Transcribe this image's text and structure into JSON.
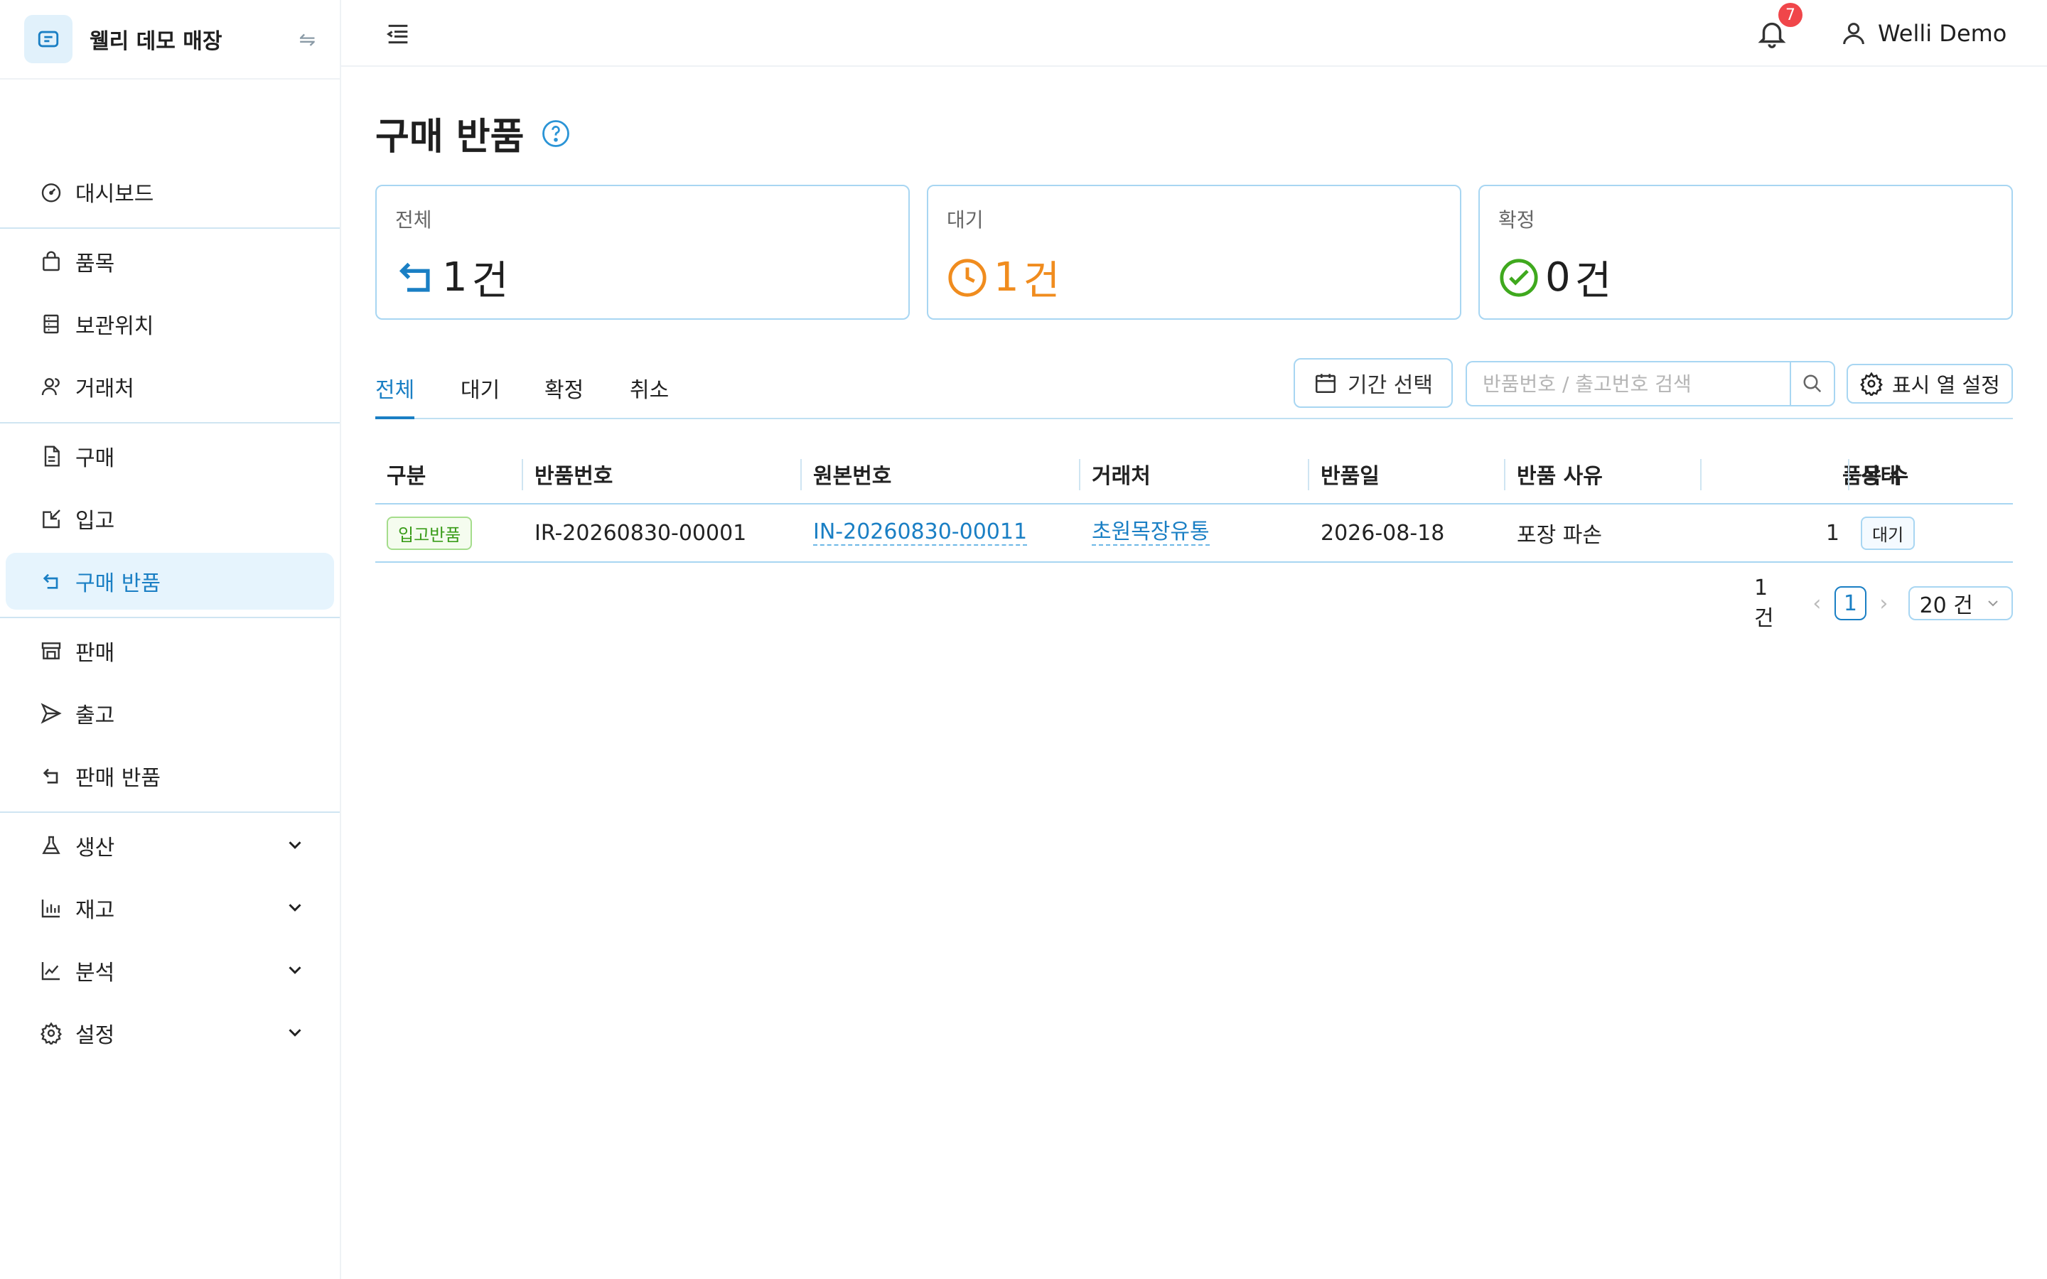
{
  "brand": {
    "name": "웰리 데모 매장",
    "swap_icon": "swap-icon"
  },
  "sidebar": {
    "items": [
      {
        "label": "대시보드",
        "icon": "dashboard-icon"
      },
      {
        "label": "품목",
        "icon": "bag-icon"
      },
      {
        "label": "보관위치",
        "icon": "storage-icon"
      },
      {
        "label": "거래처",
        "icon": "partners-icon"
      },
      {
        "label": "구매",
        "icon": "document-icon"
      },
      {
        "label": "입고",
        "icon": "inbound-icon"
      },
      {
        "label": "구매 반품",
        "icon": "return-icon"
      },
      {
        "label": "판매",
        "icon": "store-icon"
      },
      {
        "label": "출고",
        "icon": "send-icon"
      },
      {
        "label": "판매 반품",
        "icon": "return-icon"
      },
      {
        "label": "생산",
        "icon": "flask-icon"
      },
      {
        "label": "재고",
        "icon": "bar-chart-icon"
      },
      {
        "label": "분석",
        "icon": "line-chart-icon"
      },
      {
        "label": "설정",
        "icon": "gear-icon"
      }
    ],
    "active": "구매 반품"
  },
  "header": {
    "notification_count": "7",
    "user_name": "Welli Demo"
  },
  "page": {
    "title": "구매 반품"
  },
  "stats": [
    {
      "label": "전체",
      "count": "1",
      "unit": "건",
      "color": "#1a7fc4"
    },
    {
      "label": "대기",
      "count": "1",
      "unit": "건",
      "color": "#f08c1e"
    },
    {
      "label": "확정",
      "count": "0",
      "unit": "건",
      "color": "#3fa91e"
    }
  ],
  "tabs": [
    {
      "label": "전체",
      "active": true
    },
    {
      "label": "대기",
      "active": false
    },
    {
      "label": "확정",
      "active": false
    },
    {
      "label": "취소",
      "active": false
    }
  ],
  "toolbar": {
    "period_label": "기간 선택",
    "search_placeholder": "반품번호 / 출고번호 검색",
    "columns_label": "표시 열 설정"
  },
  "table": {
    "columns": [
      "구분",
      "반품번호",
      "원본번호",
      "거래처",
      "반품일",
      "반품 사유",
      "품목 수",
      "상태"
    ],
    "rows": [
      {
        "type": "입고반품",
        "return_no": "IR-20260830-00001",
        "origin_no": "IN-20260830-00011",
        "partner": "초원목장유통",
        "date": "2026-08-18",
        "reason": "포장 파손",
        "item_count": "1",
        "status": "대기"
      }
    ]
  },
  "pagination": {
    "total": "1건",
    "current": "1",
    "page_size": "20 건"
  },
  "colors": {
    "accent": "#1a7fc4",
    "pending": "#f08c1e",
    "confirmed": "#3fa91e",
    "badge": "#f0464a"
  }
}
